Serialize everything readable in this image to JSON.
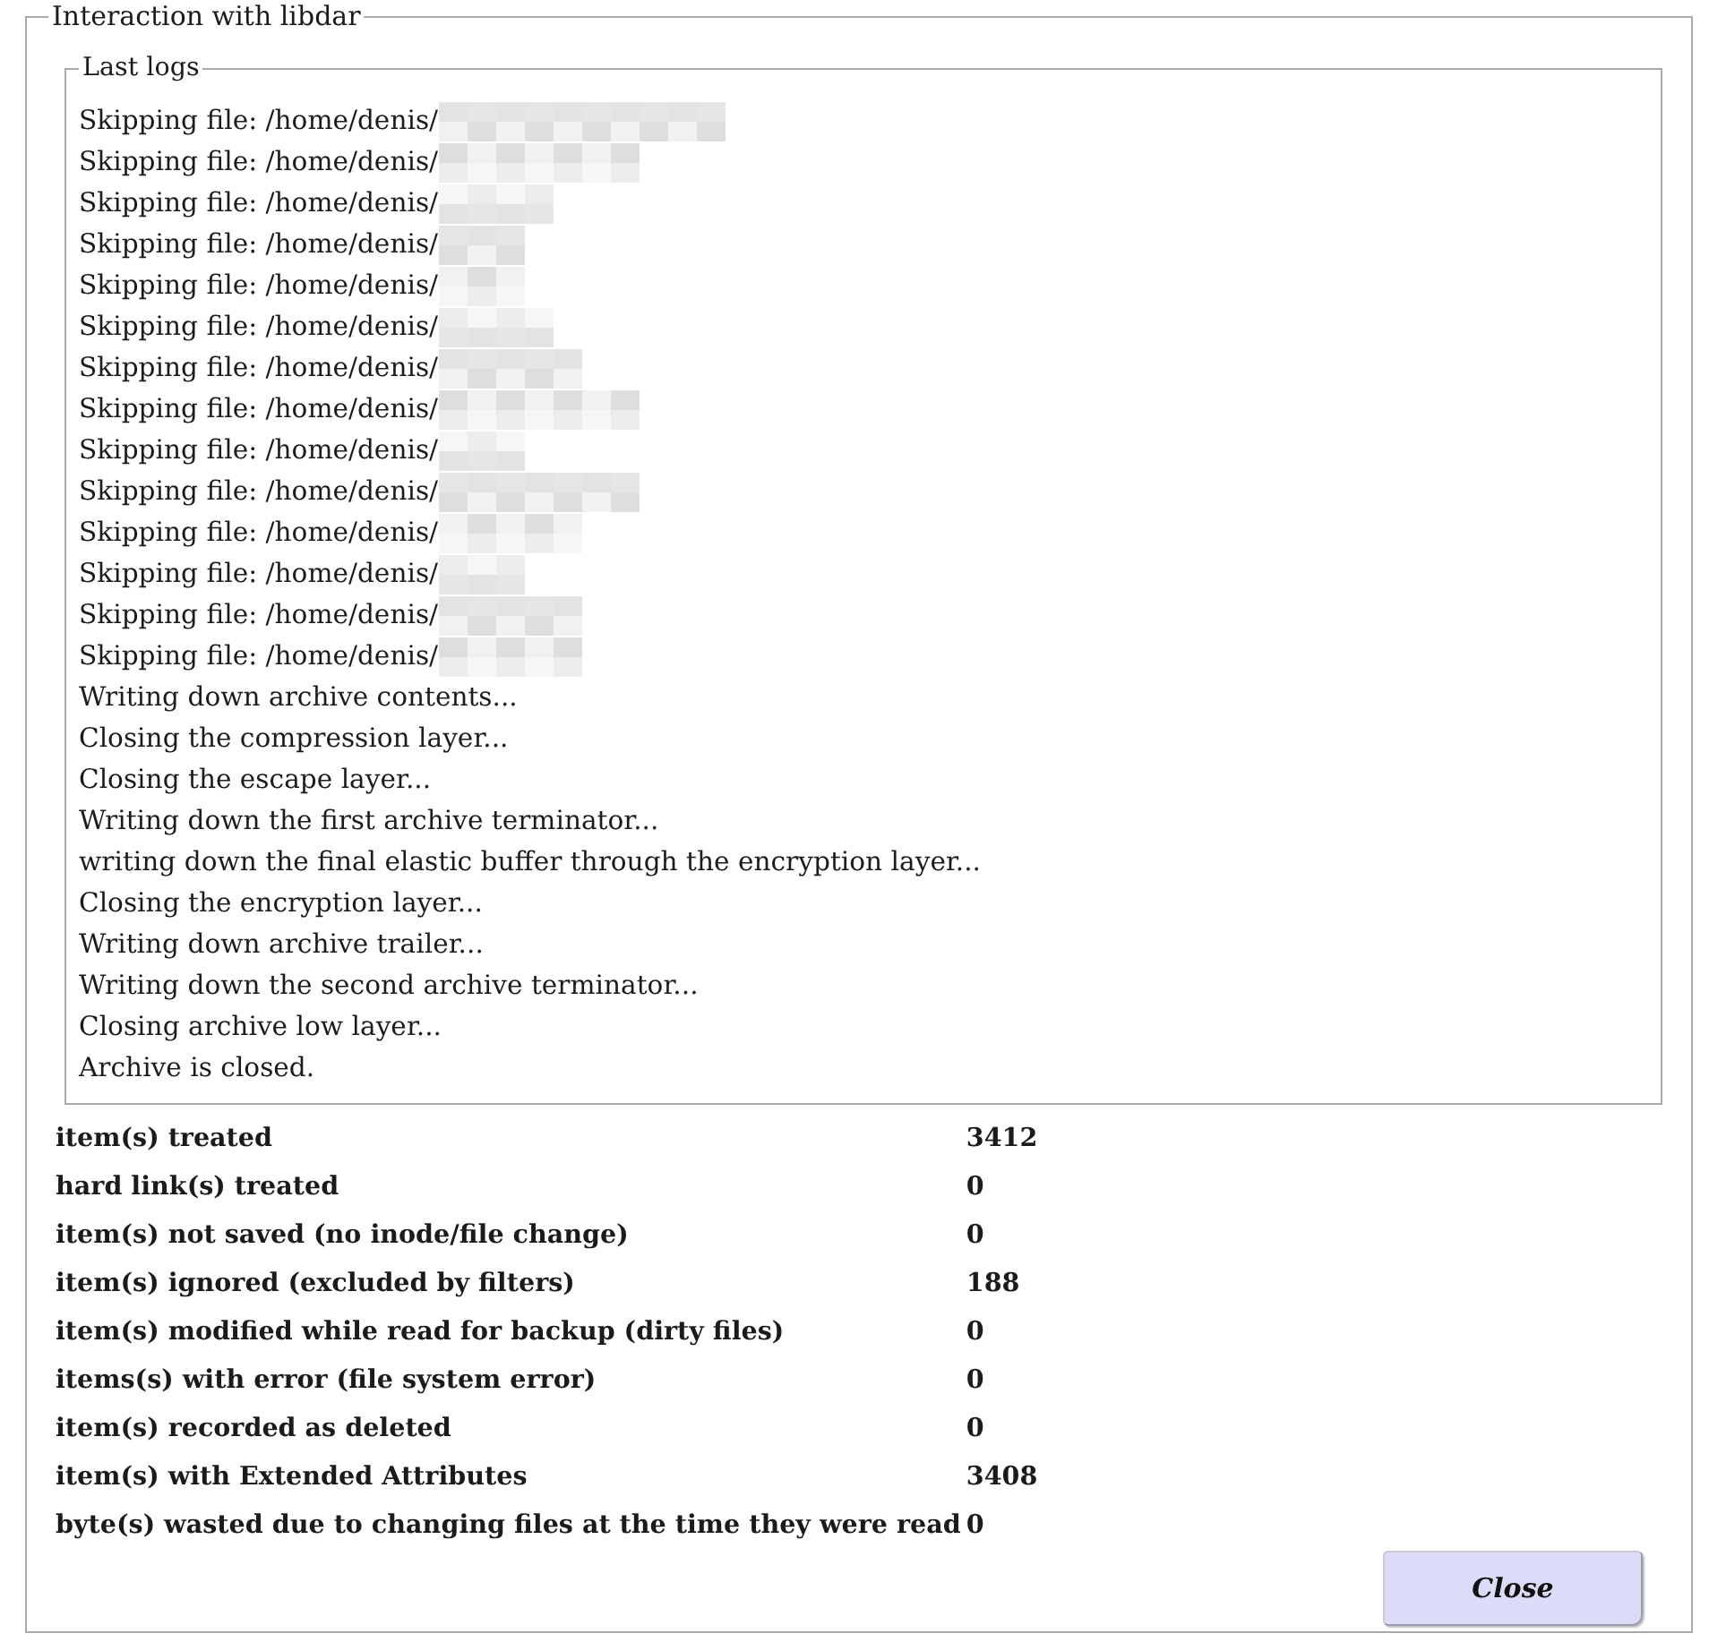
{
  "window": {
    "title": "Interaction with libdar"
  },
  "logs": {
    "title": "Last logs",
    "lines": [
      {
        "text": "Skipping file: /home/denis/",
        "redacted": true
      },
      {
        "text": "Skipping file: /home/denis/",
        "redacted": true
      },
      {
        "text": "Skipping file: /home/denis/",
        "redacted": true
      },
      {
        "text": "Skipping file: /home/denis/",
        "redacted": true
      },
      {
        "text": "Skipping file: /home/denis/",
        "redacted": true
      },
      {
        "text": "Skipping file: /home/denis/",
        "redacted": true
      },
      {
        "text": "Skipping file: /home/denis/",
        "redacted": true
      },
      {
        "text": "Skipping file: /home/denis/",
        "redacted": true
      },
      {
        "text": "Skipping file: /home/denis/",
        "redacted": true
      },
      {
        "text": "Skipping file: /home/denis/",
        "redacted": true
      },
      {
        "text": "Skipping file: /home/denis/",
        "redacted": true
      },
      {
        "text": "Skipping file: /home/denis/",
        "redacted": true
      },
      {
        "text": "Skipping file: /home/denis/",
        "redacted": true
      },
      {
        "text": "Skipping file: /home/denis/",
        "redacted": true
      },
      {
        "text": "Writing down archive contents...",
        "redacted": false
      },
      {
        "text": "Closing the compression layer...",
        "redacted": false
      },
      {
        "text": "Closing the escape layer...",
        "redacted": false
      },
      {
        "text": "Writing down the first archive terminator...",
        "redacted": false
      },
      {
        "text": "writing down the final elastic buffer through the encryption layer...",
        "redacted": false
      },
      {
        "text": "Closing the encryption layer...",
        "redacted": false
      },
      {
        "text": "Writing down archive trailer...",
        "redacted": false
      },
      {
        "text": "Writing down the second archive terminator...",
        "redacted": false
      },
      {
        "text": "Closing archive low layer...",
        "redacted": false
      },
      {
        "text": "Archive is closed.",
        "redacted": false
      }
    ]
  },
  "stats": [
    {
      "label": "item(s) treated",
      "value": "3412"
    },
    {
      "label": "hard link(s) treated",
      "value": "0"
    },
    {
      "label": "item(s) not saved (no inode/file change)",
      "value": "0"
    },
    {
      "label": "item(s) ignored (excluded by filters)",
      "value": "188"
    },
    {
      "label": "item(s) modified while read for backup (dirty files)",
      "value": "0"
    },
    {
      "label": "items(s) with error (file system error)",
      "value": "0"
    },
    {
      "label": "item(s) recorded as deleted",
      "value": "0"
    },
    {
      "label": "item(s) with Extended Attributes",
      "value": "3408"
    },
    {
      "label": "byte(s) wasted due to changing files at the time they were read",
      "value": "0"
    }
  ],
  "buttons": [
    {
      "label": "Close"
    }
  ]
}
